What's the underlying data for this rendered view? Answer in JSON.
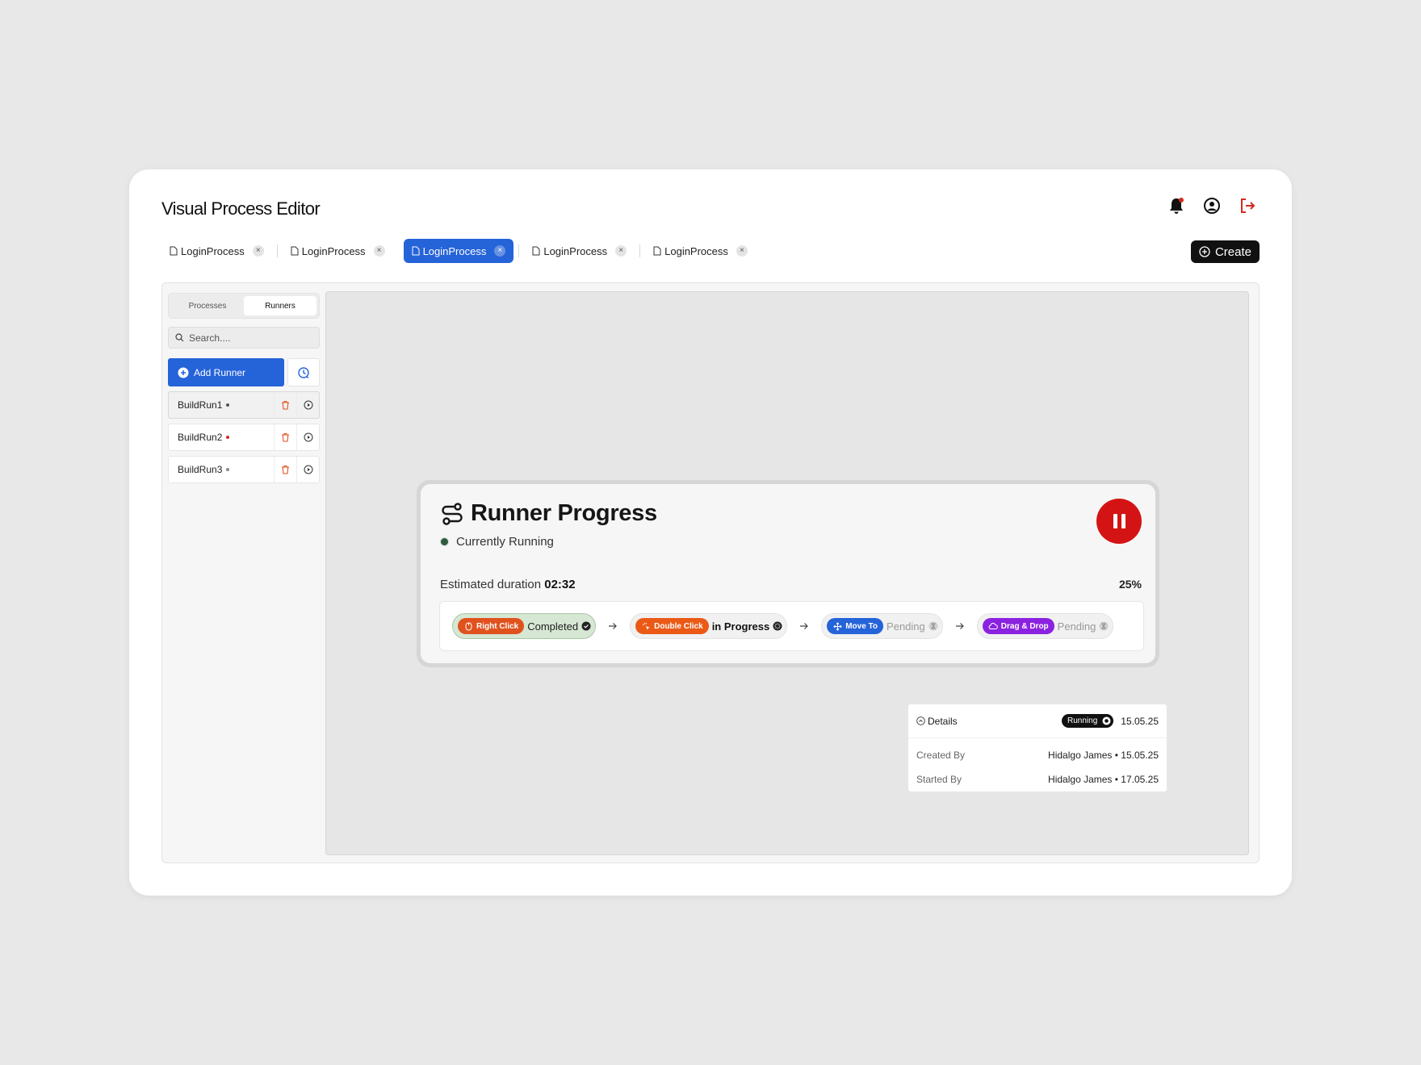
{
  "app": {
    "title": "Visual Process Editor",
    "header_icons": [
      "bell-icon",
      "user-circle-icon",
      "logout-icon"
    ],
    "notification_dot_color": "#d42b1f"
  },
  "tabs": [
    {
      "label": "LoginProcess",
      "active": false
    },
    {
      "label": "LoginProcess",
      "active": false
    },
    {
      "label": "LoginProcess",
      "active": true
    },
    {
      "label": "LoginProcess",
      "active": false
    },
    {
      "label": "LoginProcess",
      "active": false
    }
  ],
  "create_label": "Create",
  "sidebar": {
    "segments": [
      "Processes",
      "Runners"
    ],
    "selected_segment": "Runners",
    "search_placeholder": "Search....",
    "add_runner_label": "Add Runner",
    "runners": [
      {
        "name": "BuildRun1",
        "status_color": "#555555",
        "selected": true
      },
      {
        "name": "BuildRun2",
        "status_color": "#d42b1f",
        "selected": false
      },
      {
        "name": "BuildRun3",
        "status_color": "#555555",
        "selected": false
      }
    ]
  },
  "progress_card": {
    "title": "Runner Progress",
    "status": "Currently Running",
    "estimated_label": "Estimated duration",
    "estimated_value": "02:32",
    "percent": "25%",
    "steps": [
      {
        "chip": "Right Click",
        "chip_color": "#e0521d",
        "state": "Completed",
        "icon": "mouse-icon"
      },
      {
        "chip": "Double Click",
        "chip_color": "#ea5a16",
        "state": "in Progress",
        "icon": "sparkle-click-icon"
      },
      {
        "chip": "Move To",
        "chip_color": "#2563d9",
        "state": "Pending",
        "icon": "move-icon"
      },
      {
        "chip": "Drag & Drop",
        "chip_color": "#8b22e0",
        "state": "Pending",
        "icon": "cloud-icon"
      }
    ]
  },
  "details": {
    "label": "Details",
    "badge": "Running",
    "date": "15.05.25",
    "rows": [
      {
        "key": "Created By",
        "value": "Hidalgo James • 15.05.25"
      },
      {
        "key": "Started By",
        "value": "Hidalgo James • 17.05.25"
      }
    ]
  },
  "colors": {
    "accent": "#2563d9",
    "danger": "#d41414",
    "completed_bg": "#d6e7d4"
  }
}
